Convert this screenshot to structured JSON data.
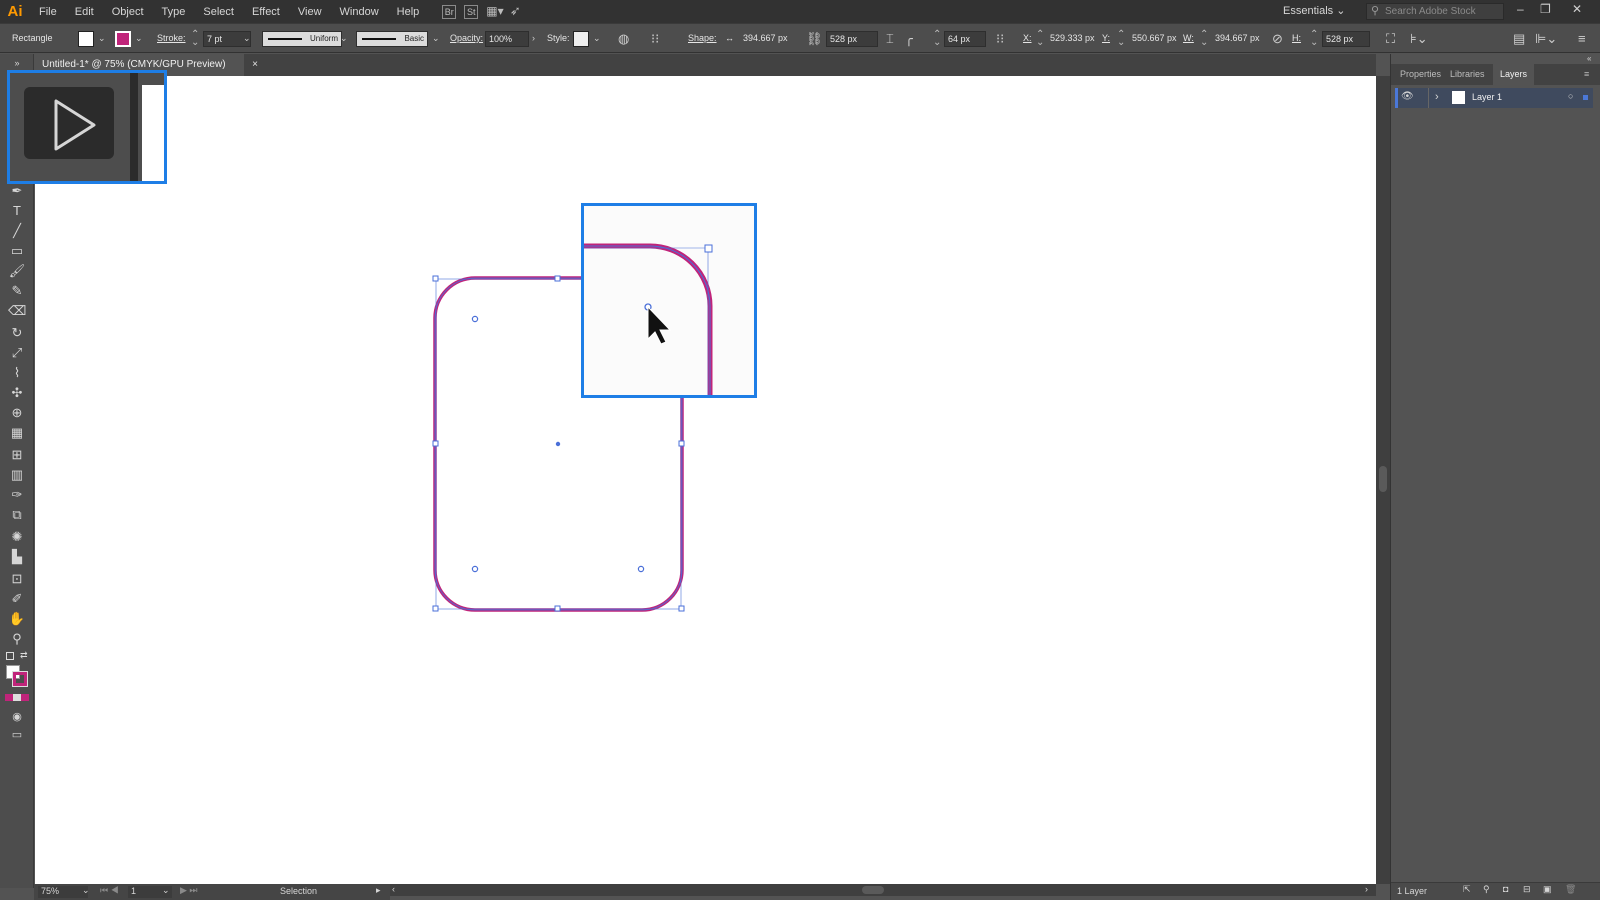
{
  "app": {
    "logo": "Ai"
  },
  "menu": [
    "File",
    "Edit",
    "Object",
    "Type",
    "Select",
    "Effect",
    "View",
    "Window",
    "Help"
  ],
  "menubar_icons": [
    "Br",
    "St"
  ],
  "workspace": "Essentials",
  "search": {
    "placeholder": "Search Adobe Stock"
  },
  "control": {
    "selection_type": "Rectangle",
    "stroke_label": "Stroke:",
    "stroke_weight": "7 pt",
    "profile": "Uniform",
    "brush": "Basic",
    "opacity_label": "Opacity:",
    "opacity": "100%",
    "style_label": "Style:",
    "shape_label": "Shape:",
    "shape_width": "394.667 px",
    "shape_height": "528 px",
    "corner_radius": "64 px",
    "x_label": "X:",
    "x": "529.333 px",
    "y_label": "Y:",
    "y": "550.667 px",
    "w_label": "W:",
    "w": "394.667 px",
    "h_label": "H:",
    "h": "528 px"
  },
  "document_tab": {
    "title": "Untitled-1* @ 75% (CMYK/GPU Preview)",
    "close": "×"
  },
  "panel": {
    "tabs": [
      "Properties",
      "Libraries",
      "Layers"
    ],
    "active_tab": "Layers",
    "layers": [
      {
        "name": "Layer 1"
      }
    ],
    "footer": "1 Layer"
  },
  "status": {
    "zoom": "75%",
    "artboard": "1",
    "tool": "Selection"
  },
  "colors": {
    "stroke": "#c0247a",
    "selection": "#4a6fd8",
    "callout": "#1e7ee6",
    "ui_bg": "#535353"
  }
}
